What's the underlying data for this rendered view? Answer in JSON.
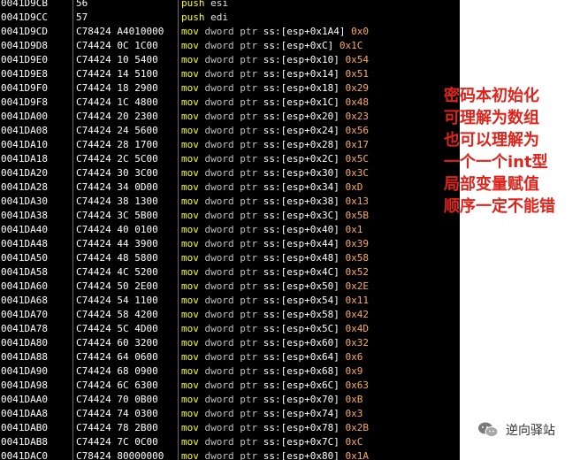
{
  "disassembly": [
    {
      "addr": "0041D9CB",
      "hex": "56",
      "mnemonic": "push",
      "operand": "esi"
    },
    {
      "addr": "0041D9CC",
      "hex": "57",
      "mnemonic": "push",
      "operand": "edi"
    },
    {
      "addr": "0041D9CD",
      "hex": "C78424 A4010000",
      "mnemonic": "mov",
      "size": "dword ptr",
      "operand": "ss:[esp+0x1A4]",
      "value": "0x0"
    },
    {
      "addr": "0041D9D8",
      "hex": "C74424 0C 1C00",
      "mnemonic": "mov",
      "size": "dword ptr",
      "operand": "ss:[esp+0xC]",
      "value": "0x1C"
    },
    {
      "addr": "0041D9E0",
      "hex": "C74424 10 5400",
      "mnemonic": "mov",
      "size": "dword ptr",
      "operand": "ss:[esp+0x10]",
      "value": "0x54"
    },
    {
      "addr": "0041D9E8",
      "hex": "C74424 14 5100",
      "mnemonic": "mov",
      "size": "dword ptr",
      "operand": "ss:[esp+0x14]",
      "value": "0x51"
    },
    {
      "addr": "0041D9F0",
      "hex": "C74424 18 2900",
      "mnemonic": "mov",
      "size": "dword ptr",
      "operand": "ss:[esp+0x18]",
      "value": "0x29"
    },
    {
      "addr": "0041D9F8",
      "hex": "C74424 1C 4800",
      "mnemonic": "mov",
      "size": "dword ptr",
      "operand": "ss:[esp+0x1C]",
      "value": "0x48"
    },
    {
      "addr": "0041DA00",
      "hex": "C74424 20 2300",
      "mnemonic": "mov",
      "size": "dword ptr",
      "operand": "ss:[esp+0x20]",
      "value": "0x23"
    },
    {
      "addr": "0041DA08",
      "hex": "C74424 24 5600",
      "mnemonic": "mov",
      "size": "dword ptr",
      "operand": "ss:[esp+0x24]",
      "value": "0x56"
    },
    {
      "addr": "0041DA10",
      "hex": "C74424 28 1700",
      "mnemonic": "mov",
      "size": "dword ptr",
      "operand": "ss:[esp+0x28]",
      "value": "0x17"
    },
    {
      "addr": "0041DA18",
      "hex": "C74424 2C 5C00",
      "mnemonic": "mov",
      "size": "dword ptr",
      "operand": "ss:[esp+0x2C]",
      "value": "0x5C"
    },
    {
      "addr": "0041DA20",
      "hex": "C74424 30 3C00",
      "mnemonic": "mov",
      "size": "dword ptr",
      "operand": "ss:[esp+0x30]",
      "value": "0x3C"
    },
    {
      "addr": "0041DA28",
      "hex": "C74424 34 0D00",
      "mnemonic": "mov",
      "size": "dword ptr",
      "operand": "ss:[esp+0x34]",
      "value": "0xD"
    },
    {
      "addr": "0041DA30",
      "hex": "C74424 38 1300",
      "mnemonic": "mov",
      "size": "dword ptr",
      "operand": "ss:[esp+0x38]",
      "value": "0x13"
    },
    {
      "addr": "0041DA38",
      "hex": "C74424 3C 5B00",
      "mnemonic": "mov",
      "size": "dword ptr",
      "operand": "ss:[esp+0x3C]",
      "value": "0x5B"
    },
    {
      "addr": "0041DA40",
      "hex": "C74424 40 0100",
      "mnemonic": "mov",
      "size": "dword ptr",
      "operand": "ss:[esp+0x40]",
      "value": "0x1"
    },
    {
      "addr": "0041DA48",
      "hex": "C74424 44 3900",
      "mnemonic": "mov",
      "size": "dword ptr",
      "operand": "ss:[esp+0x44]",
      "value": "0x39"
    },
    {
      "addr": "0041DA50",
      "hex": "C74424 48 5800",
      "mnemonic": "mov",
      "size": "dword ptr",
      "operand": "ss:[esp+0x48]",
      "value": "0x58"
    },
    {
      "addr": "0041DA58",
      "hex": "C74424 4C 5200",
      "mnemonic": "mov",
      "size": "dword ptr",
      "operand": "ss:[esp+0x4C]",
      "value": "0x52"
    },
    {
      "addr": "0041DA60",
      "hex": "C74424 50 2E00",
      "mnemonic": "mov",
      "size": "dword ptr",
      "operand": "ss:[esp+0x50]",
      "value": "0x2E"
    },
    {
      "addr": "0041DA68",
      "hex": "C74424 54 1100",
      "mnemonic": "mov",
      "size": "dword ptr",
      "operand": "ss:[esp+0x54]",
      "value": "0x11"
    },
    {
      "addr": "0041DA70",
      "hex": "C74424 58 4200",
      "mnemonic": "mov",
      "size": "dword ptr",
      "operand": "ss:[esp+0x58]",
      "value": "0x42"
    },
    {
      "addr": "0041DA78",
      "hex": "C74424 5C 4D00",
      "mnemonic": "mov",
      "size": "dword ptr",
      "operand": "ss:[esp+0x5C]",
      "value": "0x4D"
    },
    {
      "addr": "0041DA80",
      "hex": "C74424 60 3200",
      "mnemonic": "mov",
      "size": "dword ptr",
      "operand": "ss:[esp+0x60]",
      "value": "0x32"
    },
    {
      "addr": "0041DA88",
      "hex": "C74424 64 0600",
      "mnemonic": "mov",
      "size": "dword ptr",
      "operand": "ss:[esp+0x64]",
      "value": "0x6"
    },
    {
      "addr": "0041DA90",
      "hex": "C74424 68 0900",
      "mnemonic": "mov",
      "size": "dword ptr",
      "operand": "ss:[esp+0x68]",
      "value": "0x9"
    },
    {
      "addr": "0041DA98",
      "hex": "C74424 6C 6300",
      "mnemonic": "mov",
      "size": "dword ptr",
      "operand": "ss:[esp+0x6C]",
      "value": "0x63"
    },
    {
      "addr": "0041DAA0",
      "hex": "C74424 70 0B00",
      "mnemonic": "mov",
      "size": "dword ptr",
      "operand": "ss:[esp+0x70]",
      "value": "0xB"
    },
    {
      "addr": "0041DAA8",
      "hex": "C74424 74 0300",
      "mnemonic": "mov",
      "size": "dword ptr",
      "operand": "ss:[esp+0x74]",
      "value": "0x3"
    },
    {
      "addr": "0041DAB0",
      "hex": "C74424 78 2B00",
      "mnemonic": "mov",
      "size": "dword ptr",
      "operand": "ss:[esp+0x78]",
      "value": "0x2B"
    },
    {
      "addr": "0041DAB8",
      "hex": "C74424 7C 0C00",
      "mnemonic": "mov",
      "size": "dword ptr",
      "operand": "ss:[esp+0x7C]",
      "value": "0xC"
    },
    {
      "addr": "0041DAC0",
      "hex": "C78424 80000000",
      "mnemonic": "mov",
      "size": "dword ptr",
      "operand": "ss:[esp+0x80]",
      "value": "0x1A"
    }
  ],
  "annotation": {
    "lines": [
      "密码本初始化",
      "可理解为数组",
      "也可以理解为",
      "一个一个int型",
      "局部变量赋值",
      "顺序一定不能错"
    ]
  },
  "watermark": {
    "text": "逆向驿站",
    "icon": "wechat-icon"
  },
  "colors": {
    "background": "#000000",
    "mnemonic": "#ffff00",
    "immediate": "#ffaa55",
    "annotation": "#e0241b"
  }
}
